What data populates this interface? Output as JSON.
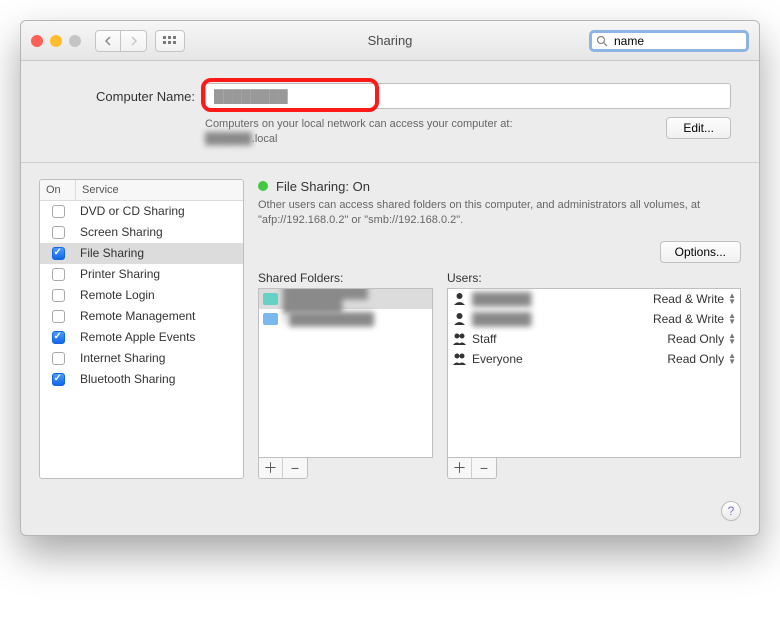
{
  "window": {
    "title": "Sharing"
  },
  "toolbar": {
    "search_value": "name"
  },
  "computer": {
    "label": "Computer Name:",
    "value": "████████",
    "subtext": "Computers on your local network can access your computer at:",
    "hostname_blur": "██████",
    "hostname_suffix": ".local",
    "edit_label": "Edit..."
  },
  "services": {
    "header_on": "On",
    "header_service": "Service",
    "items": [
      {
        "label": "DVD or CD Sharing",
        "checked": false,
        "selected": false
      },
      {
        "label": "Screen Sharing",
        "checked": false,
        "selected": false
      },
      {
        "label": "File Sharing",
        "checked": true,
        "selected": true
      },
      {
        "label": "Printer Sharing",
        "checked": false,
        "selected": false
      },
      {
        "label": "Remote Login",
        "checked": false,
        "selected": false
      },
      {
        "label": "Remote Management",
        "checked": false,
        "selected": false
      },
      {
        "label": "Remote Apple Events",
        "checked": true,
        "selected": false
      },
      {
        "label": "Internet Sharing",
        "checked": false,
        "selected": false
      },
      {
        "label": "Bluetooth Sharing",
        "checked": true,
        "selected": false
      }
    ]
  },
  "detail": {
    "status_label": "File Sharing: On",
    "description": "Other users can access shared folders on this computer, and administrators all volumes, at \"afp://192.168.0.2\" or \"smb://192.168.0.2\".",
    "options_label": "Options...",
    "folders_label": "Shared Folders:",
    "users_label": "Users:",
    "folders": [
      {
        "label": "██████████ ███████",
        "selected": true,
        "share": true
      },
      {
        "label": "i ██████████",
        "selected": false,
        "share": false
      }
    ],
    "users": [
      {
        "icon": "person",
        "label": "███████",
        "perm": "Read & Write"
      },
      {
        "icon": "person",
        "label": "███████",
        "perm": "Read & Write"
      },
      {
        "icon": "people",
        "label": "Staff",
        "perm": "Read Only"
      },
      {
        "icon": "people3",
        "label": "Everyone",
        "perm": "Read Only"
      }
    ]
  }
}
